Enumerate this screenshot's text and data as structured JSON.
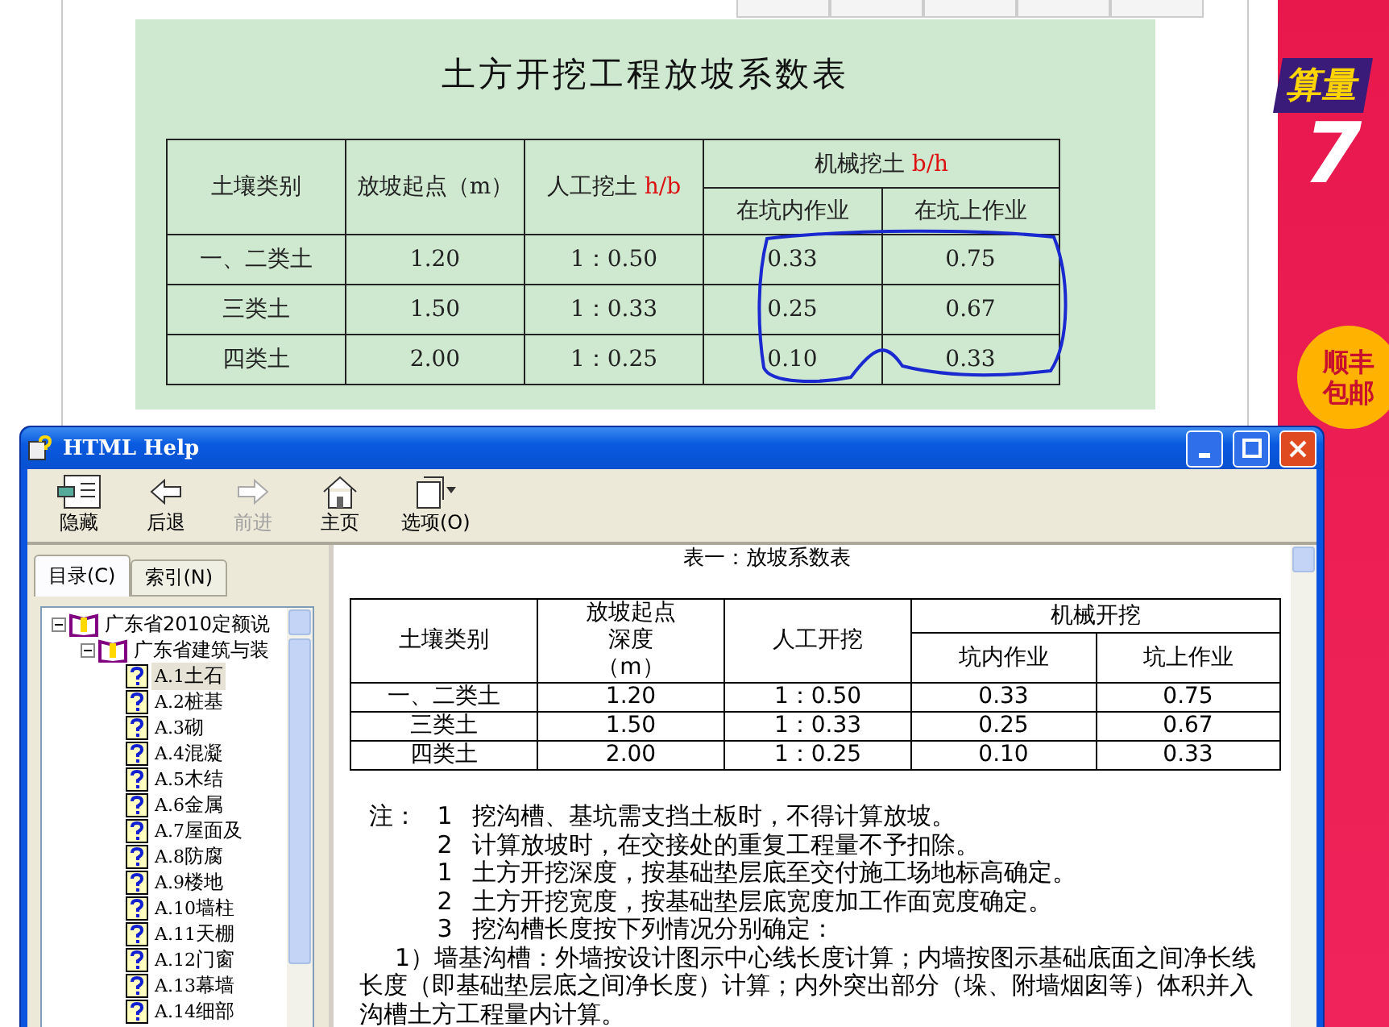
{
  "document": {
    "title": "土方开挖工程放坡系数表",
    "table": {
      "columns": [
        {
          "label": "土壤类别"
        },
        {
          "label": "放坡起点（m）"
        },
        {
          "label": "人工挖土",
          "unit": "h/b"
        },
        {
          "label": "机械挖土",
          "unit": "b/h",
          "colspan": 2
        }
      ],
      "subcolumns": [
        "在坑内作业",
        "在坑上作业"
      ],
      "rows": [
        [
          "一、二类土",
          "1.20",
          "1：0.50",
          "0.33",
          "0.75"
        ],
        [
          "三类土",
          "1.50",
          "1：0.33",
          "0.25",
          "0.67"
        ],
        [
          "四类土",
          "2.00",
          "1：0.25",
          "0.10",
          "0.33"
        ]
      ]
    }
  },
  "ad": {
    "headline": "算量",
    "number": "7",
    "badge": [
      "顺丰",
      "包邮"
    ]
  },
  "help_window": {
    "title": "HTML Help",
    "toolbar": [
      {
        "kind": "hide",
        "label": "隐藏",
        "disabled": false
      },
      {
        "kind": "back",
        "label": "后退",
        "disabled": false
      },
      {
        "kind": "forward",
        "label": "前进",
        "disabled": true
      },
      {
        "kind": "home",
        "label": "主页",
        "disabled": false
      },
      {
        "kind": "options",
        "label": "选项(O)",
        "disabled": false
      }
    ],
    "tabs": [
      {
        "label": "目录(C)",
        "selected": true
      },
      {
        "label": "索引(N)",
        "selected": false
      }
    ],
    "tree": [
      {
        "label": "广东省2010定额说",
        "expanded": true,
        "children": [
          {
            "label": "广东省建筑与装",
            "expanded": true,
            "children": [
              {
                "code": "A.1",
                "label": "土石",
                "selected": true
              },
              {
                "code": "A.2",
                "label": "桩基",
                "selected": false
              },
              {
                "code": "A.3",
                "label": "砌",
                "selected": false
              },
              {
                "code": "A.4",
                "label": "混凝",
                "selected": false
              },
              {
                "code": "A.5",
                "label": "木结",
                "selected": false
              },
              {
                "code": "A.6",
                "label": "金属",
                "selected": false
              },
              {
                "code": "A.7",
                "label": "屋面及",
                "selected": false
              },
              {
                "code": "A.8",
                "label": "防腐",
                "selected": false
              },
              {
                "code": "A.9",
                "label": "楼地",
                "selected": false
              },
              {
                "code": "A.10",
                "label": "墙柱",
                "selected": false
              },
              {
                "code": "A.11",
                "label": "天棚",
                "selected": false
              },
              {
                "code": "A.12",
                "label": "门窗",
                "selected": false
              },
              {
                "code": "A.13",
                "label": "幕墙",
                "selected": false
              },
              {
                "code": "A.14",
                "label": "细部",
                "selected": false
              }
            ]
          }
        ]
      }
    ],
    "content": {
      "caption": "表一：放坡系数表",
      "table": {
        "columns": [
          {
            "label": "土壤类别"
          },
          {
            "label": "放坡起点深度（m）"
          },
          {
            "label": "人工开挖"
          },
          {
            "label": "机械开挖",
            "colspan": 2
          }
        ],
        "subcolumns": [
          "坑内作业",
          "坑上作业"
        ],
        "rows": [
          [
            "一、二类土",
            "1.20",
            "1：0.50",
            "0.33",
            "0.75"
          ],
          [
            "三类土",
            "1.50",
            "1：0.33",
            "0.25",
            "0.67"
          ],
          [
            "四类土",
            "2.00",
            "1：0.25",
            "0.10",
            "0.33"
          ]
        ]
      },
      "notes": [
        {
          "kind": "item",
          "lead": "注：",
          "number": "1",
          "text": "挖沟槽、基坑需支挡土板时，不得计算放坡。"
        },
        {
          "kind": "item",
          "number": "2",
          "text": "计算放坡时，在交接处的重复工程量不予扣除。"
        },
        {
          "kind": "item",
          "number": "1",
          "text": "土方开挖深度，按基础垫层底至交付施工场地标高确定。"
        },
        {
          "kind": "item",
          "number": "2",
          "text": "土方开挖宽度，按基础垫层底宽度加工作面宽度确定。"
        },
        {
          "kind": "item",
          "number": "3",
          "text": "挖沟槽长度按下列情况分别确定："
        },
        {
          "kind": "para",
          "text": "1）墙基沟槽：外墙按设计图示中心线长度计算；内墙按图示基础底面之间净长线长度（即基础垫层底之间净长度）计算；内外突出部分（垛、附墙烟囱等）体积并入沟槽土方工程量内计算。"
        }
      ]
    }
  }
}
